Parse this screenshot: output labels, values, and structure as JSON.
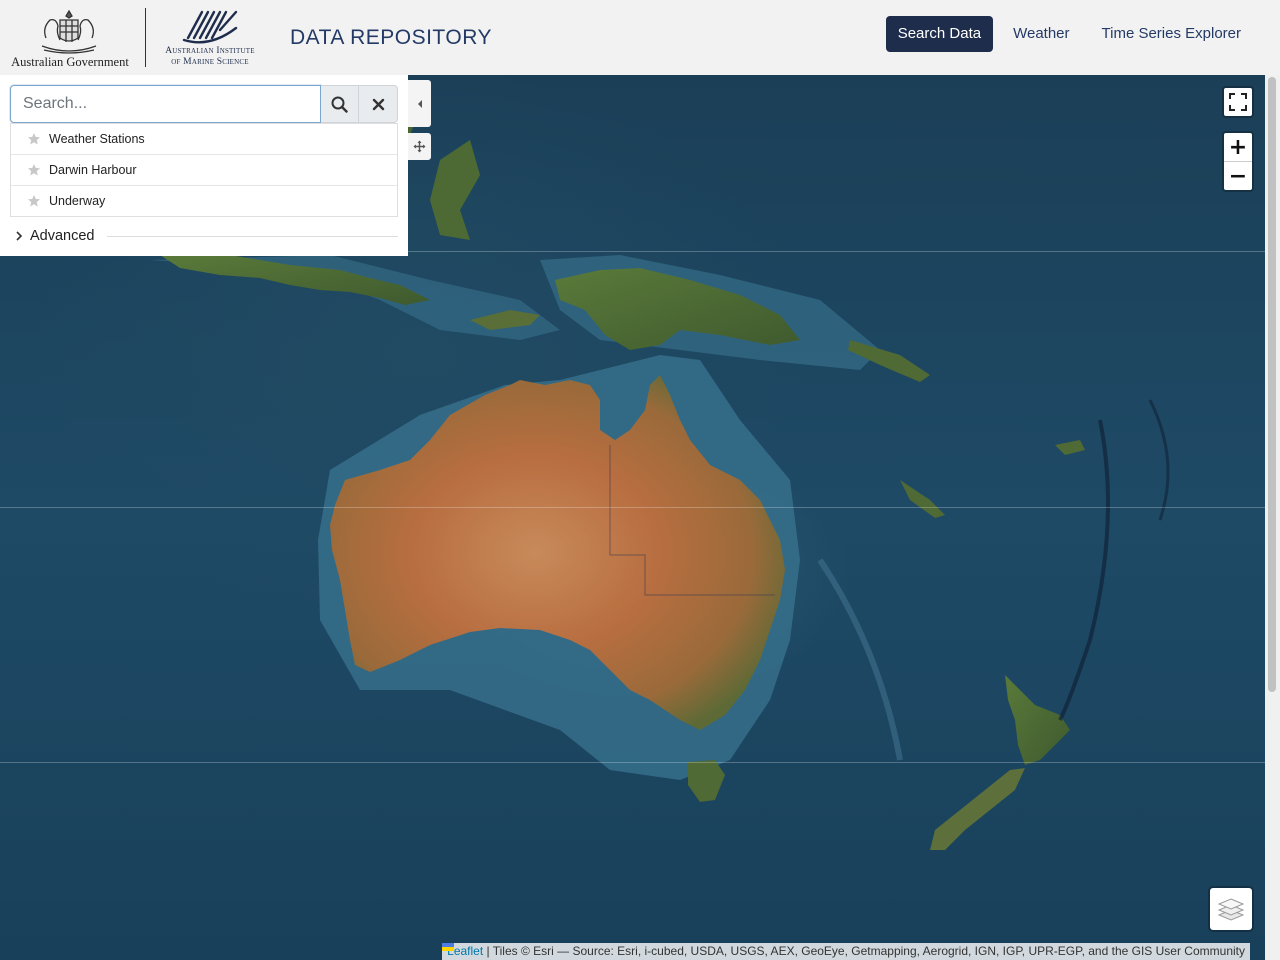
{
  "header": {
    "gov_logo_text": "Australian Government",
    "aims_logo_text_line1": "Australian Institute",
    "aims_logo_text_line2": "of Marine Science",
    "title": "DATA REPOSITORY",
    "nav": [
      {
        "label": "Search Data",
        "active": true
      },
      {
        "label": "Weather",
        "active": false
      },
      {
        "label": "Time Series Explorer",
        "active": false
      }
    ]
  },
  "search": {
    "placeholder": "Search...",
    "value": "",
    "saved_searches": [
      {
        "label": "Weather Stations",
        "icon": "star-icon"
      },
      {
        "label": "Darwin Harbour",
        "icon": "star-icon"
      },
      {
        "label": "Underway",
        "icon": "star-icon"
      }
    ],
    "advanced_label": "Advanced"
  },
  "map": {
    "zoom_in_label": "+",
    "zoom_out_label": "−",
    "attribution": {
      "leaflet_link": "Leaflet",
      "text": " | Tiles © Esri — Source: Esri, i-cubed, USDA, USGS, AEX, GeoEye, Getmapping, Aerogrid, IGN, IGP, UPR-EGP, and the GIS User Community"
    },
    "colors": {
      "ocean": "#1e4a66",
      "shelf": "#3a7490",
      "land_desert": "#b86e40",
      "land_green": "#4a6a32"
    }
  },
  "theme": {
    "navy": "#1f2d4d",
    "title_blue": "#243a66"
  }
}
